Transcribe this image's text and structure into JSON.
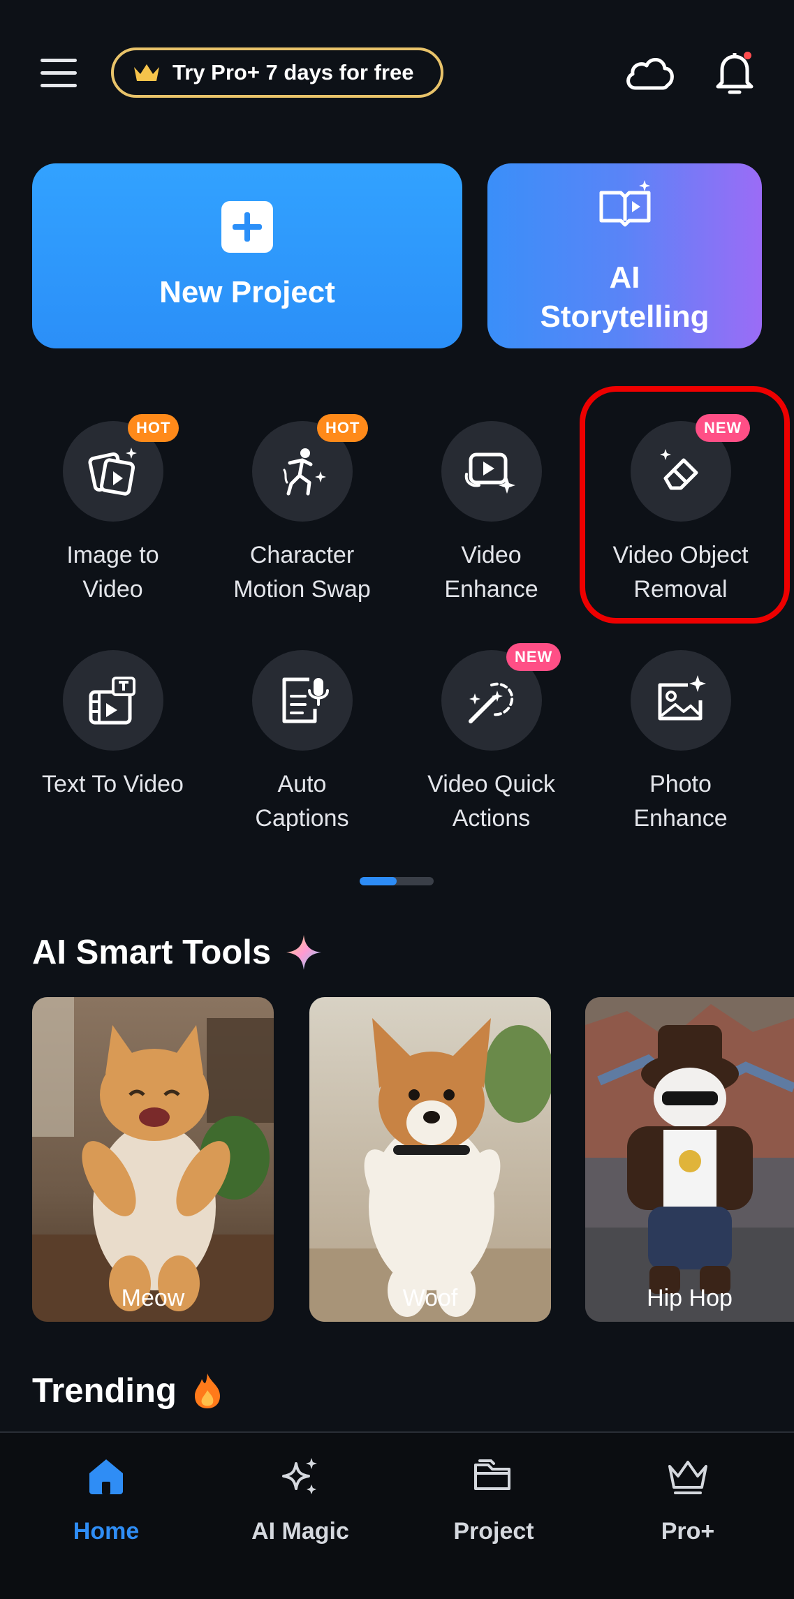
{
  "header": {
    "promo_label": "Try Pro+ 7 days for free",
    "icons": [
      "menu-icon",
      "crown-icon",
      "cloud-icon",
      "bell-icon"
    ]
  },
  "cards": {
    "new_project": "New Project",
    "ai_storytelling_line1": "AI",
    "ai_storytelling_line2": "Storytelling"
  },
  "tools": [
    {
      "line1": "Image to",
      "line2": "Video",
      "badge": "HOT",
      "icon": "image-to-video-icon"
    },
    {
      "line1": "Character",
      "line2": "Motion Swap",
      "badge": "HOT",
      "icon": "character-motion-icon"
    },
    {
      "line1": "Video",
      "line2": "Enhance",
      "badge": "",
      "icon": "video-enhance-icon"
    },
    {
      "line1": "Video Object",
      "line2": "Removal",
      "badge": "NEW",
      "icon": "eraser-icon"
    },
    {
      "line1": "Text To Video",
      "line2": "",
      "badge": "",
      "icon": "text-to-video-icon"
    },
    {
      "line1": "Auto",
      "line2": "Captions",
      "badge": "",
      "icon": "auto-captions-icon"
    },
    {
      "line1": "Video Quick",
      "line2": "Actions",
      "badge": "NEW",
      "icon": "magic-wand-icon"
    },
    {
      "line1": "Photo",
      "line2": "Enhance",
      "badge": "",
      "icon": "photo-enhance-icon"
    }
  ],
  "smart_tools": {
    "title": "AI Smart Tools",
    "items": [
      {
        "label": "Meow"
      },
      {
        "label": "Woof"
      },
      {
        "label": "Hip Hop"
      }
    ]
  },
  "trending": {
    "title": "Trending"
  },
  "bottom_nav": [
    {
      "label": "Home",
      "icon": "home-icon",
      "active": true
    },
    {
      "label": "AI Magic",
      "icon": "sparkles-icon",
      "active": false
    },
    {
      "label": "Project",
      "icon": "folder-icon",
      "active": false
    },
    {
      "label": "Pro+",
      "icon": "crown-icon",
      "active": false
    }
  ],
  "colors": {
    "background": "#0d1117",
    "accent_blue": "#2b8ff8",
    "hot_badge": "#ff8a1a",
    "new_badge": "#ff4f86",
    "highlight": "#ee0000"
  }
}
